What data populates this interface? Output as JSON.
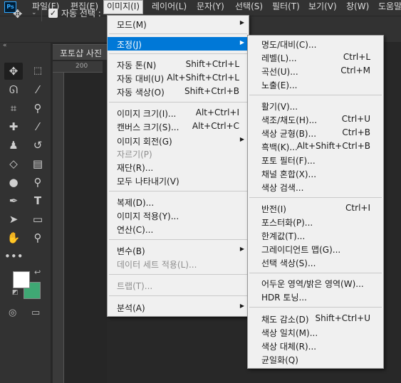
{
  "app": {
    "logo": "Ps"
  },
  "menubar": {
    "items": [
      "파일(F)",
      "편집(E)",
      "이미지(I)",
      "레이어(L)",
      "문자(Y)",
      "선택(S)",
      "필터(T)",
      "보기(V)",
      "창(W)",
      "도움말"
    ]
  },
  "options": {
    "auto_select_label": "자동 선택 :"
  },
  "document": {
    "tab_title": "포토샵 사진",
    "ruler_label": "200"
  },
  "colors": {
    "foreground": "#ffffff",
    "background": "#3fa874",
    "highlight": "#0078d7"
  },
  "tools": [
    "move-icon",
    "marquee-icon",
    "lasso-icon",
    "magic-wand-icon",
    "crop-icon",
    "eyedropper-icon",
    "healing-brush-icon",
    "brush-icon",
    "clone-stamp-icon",
    "history-brush-icon",
    "eraser-icon",
    "gradient-icon",
    "blur-icon",
    "dodge-icon",
    "pen-icon",
    "type-icon",
    "path-select-icon",
    "rectangle-icon",
    "hand-icon",
    "zoom-icon",
    "more-icon"
  ],
  "image_menu": {
    "items": [
      {
        "label": "모드(M)",
        "shortcut": "",
        "submenu": true,
        "disabled": false,
        "highlighted": false
      },
      {
        "label": "조정(J)",
        "shortcut": "",
        "submenu": true,
        "disabled": false,
        "highlighted": true
      },
      {
        "label": "자동 톤(N)",
        "shortcut": "Shift+Ctrl+L",
        "submenu": false,
        "disabled": false,
        "highlighted": false
      },
      {
        "label": "자동 대비(U)",
        "shortcut": "Alt+Shift+Ctrl+L",
        "submenu": false,
        "disabled": false,
        "highlighted": false
      },
      {
        "label": "자동 색상(O)",
        "shortcut": "Shift+Ctrl+B",
        "submenu": false,
        "disabled": false,
        "highlighted": false
      },
      {
        "label": "이미지 크기(I)...",
        "shortcut": "Alt+Ctrl+I",
        "submenu": false,
        "disabled": false,
        "highlighted": false
      },
      {
        "label": "캔버스 크기(S)...",
        "shortcut": "Alt+Ctrl+C",
        "submenu": false,
        "disabled": false,
        "highlighted": false
      },
      {
        "label": "이미지 회전(G)",
        "shortcut": "",
        "submenu": true,
        "disabled": false,
        "highlighted": false
      },
      {
        "label": "자르기(P)",
        "shortcut": "",
        "submenu": false,
        "disabled": true,
        "highlighted": false
      },
      {
        "label": "재단(R)...",
        "shortcut": "",
        "submenu": false,
        "disabled": false,
        "highlighted": false
      },
      {
        "label": "모두 나타내기(V)",
        "shortcut": "",
        "submenu": false,
        "disabled": false,
        "highlighted": false
      },
      {
        "label": "복제(D)...",
        "shortcut": "",
        "submenu": false,
        "disabled": false,
        "highlighted": false
      },
      {
        "label": "이미지 적용(Y)...",
        "shortcut": "",
        "submenu": false,
        "disabled": false,
        "highlighted": false
      },
      {
        "label": "연산(C)...",
        "shortcut": "",
        "submenu": false,
        "disabled": false,
        "highlighted": false
      },
      {
        "label": "변수(B)",
        "shortcut": "",
        "submenu": true,
        "disabled": false,
        "highlighted": false
      },
      {
        "label": "데이터 세트 적용(L)...",
        "shortcut": "",
        "submenu": false,
        "disabled": true,
        "highlighted": false
      },
      {
        "label": "트랩(T)...",
        "shortcut": "",
        "submenu": false,
        "disabled": true,
        "highlighted": false
      },
      {
        "label": "분석(A)",
        "shortcut": "",
        "submenu": true,
        "disabled": false,
        "highlighted": false
      }
    ]
  },
  "adjust_menu": {
    "items": [
      {
        "label": "명도/대비(C)...",
        "shortcut": ""
      },
      {
        "label": "레벨(L)...",
        "shortcut": "Ctrl+L"
      },
      {
        "label": "곡선(U)...",
        "shortcut": "Ctrl+M"
      },
      {
        "label": "노출(E)...",
        "shortcut": ""
      },
      {
        "label": "활기(V)...",
        "shortcut": ""
      },
      {
        "label": "색조/채도(H)...",
        "shortcut": "Ctrl+U"
      },
      {
        "label": "색상 균형(B)...",
        "shortcut": "Ctrl+B"
      },
      {
        "label": "흑백(K)...",
        "shortcut": "Alt+Shift+Ctrl+B"
      },
      {
        "label": "포토 필터(F)...",
        "shortcut": ""
      },
      {
        "label": "채널 혼합(X)...",
        "shortcut": ""
      },
      {
        "label": "색상 검색...",
        "shortcut": ""
      },
      {
        "label": "반전(I)",
        "shortcut": "Ctrl+I"
      },
      {
        "label": "포스터화(P)...",
        "shortcut": ""
      },
      {
        "label": "한계값(T)...",
        "shortcut": ""
      },
      {
        "label": "그레이디언트 맵(G)...",
        "shortcut": ""
      },
      {
        "label": "선택 색상(S)...",
        "shortcut": ""
      },
      {
        "label": "어두운 영역/밝은 영역(W)...",
        "shortcut": ""
      },
      {
        "label": "HDR 토닝...",
        "shortcut": ""
      },
      {
        "label": "채도 감소(D)",
        "shortcut": "Shift+Ctrl+U"
      },
      {
        "label": "색상 일치(M)...",
        "shortcut": ""
      },
      {
        "label": "색상 대체(R)...",
        "shortcut": ""
      },
      {
        "label": "균일화(Q)",
        "shortcut": ""
      }
    ]
  }
}
